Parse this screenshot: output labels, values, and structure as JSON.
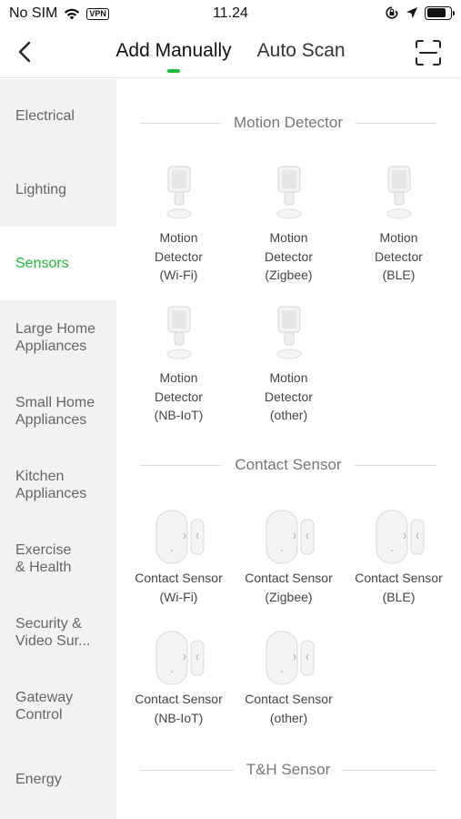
{
  "status_bar": {
    "carrier": "No SIM",
    "vpn": "VPN",
    "time": "11.24"
  },
  "nav": {
    "tabs": [
      "Add Manually",
      "Auto Scan"
    ],
    "active_tab": "Add Manually",
    "accent_color": "#1dbf3a"
  },
  "sidebar": {
    "items": [
      {
        "label": "Electrical"
      },
      {
        "label": "Lighting"
      },
      {
        "label": "Sensors",
        "active": true
      },
      {
        "label": "Large Home\nAppliances"
      },
      {
        "label": "Small Home\nAppliances"
      },
      {
        "label": "Kitchen\nAppliances"
      },
      {
        "label": "Exercise\n& Health"
      },
      {
        "label": "Security &\nVideo Sur..."
      },
      {
        "label": "Gateway\nControl"
      },
      {
        "label": "Energy"
      }
    ]
  },
  "sections": [
    {
      "title": "Motion Detector",
      "devices": [
        {
          "name": "Motion\nDetector\n(Wi-Fi)",
          "icon": "motion-detector-icon"
        },
        {
          "name": "Motion\nDetector\n(Zigbee)",
          "icon": "motion-detector-icon"
        },
        {
          "name": "Motion\nDetector\n(BLE)",
          "icon": "motion-detector-icon"
        },
        {
          "name": "Motion\nDetector\n(NB-IoT)",
          "icon": "motion-detector-icon"
        },
        {
          "name": "Motion\nDetector\n(other)",
          "icon": "motion-detector-icon"
        }
      ]
    },
    {
      "title": "Contact Sensor",
      "devices": [
        {
          "name": "Contact Sensor\n(Wi-Fi)",
          "icon": "contact-sensor-icon"
        },
        {
          "name": "Contact Sensor\n(Zigbee)",
          "icon": "contact-sensor-icon"
        },
        {
          "name": "Contact Sensor\n(BLE)",
          "icon": "contact-sensor-icon"
        },
        {
          "name": "Contact Sensor\n(NB-IoT)",
          "icon": "contact-sensor-icon"
        },
        {
          "name": "Contact Sensor\n(other)",
          "icon": "contact-sensor-icon"
        }
      ]
    },
    {
      "title": "T&H Sensor",
      "devices": []
    }
  ]
}
